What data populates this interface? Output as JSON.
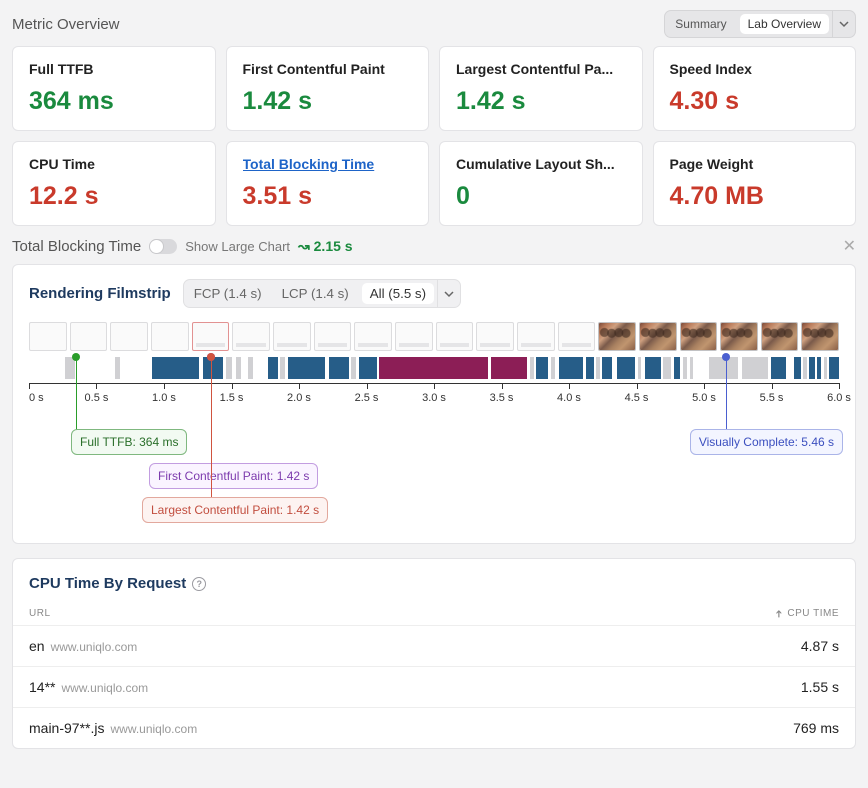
{
  "header": {
    "title": "Metric Overview",
    "tabs": {
      "summary": "Summary",
      "lab": "Lab Overview",
      "active": "lab"
    }
  },
  "metrics": [
    {
      "label": "Full TTFB",
      "value": "364 ms",
      "status": "good",
      "link": false
    },
    {
      "label": "First Contentful Paint",
      "value": "1.42 s",
      "status": "good",
      "link": false
    },
    {
      "label": "Largest Contentful Pa...",
      "value": "1.42 s",
      "status": "good",
      "link": false
    },
    {
      "label": "Speed Index",
      "value": "4.30 s",
      "status": "bad",
      "link": false
    },
    {
      "label": "CPU Time",
      "value": "12.2 s",
      "status": "bad",
      "link": false
    },
    {
      "label": "Total Blocking Time",
      "value": "3.51 s",
      "status": "bad",
      "link": true
    },
    {
      "label": "Cumulative Layout Sh...",
      "value": "0",
      "status": "good",
      "link": false
    },
    {
      "label": "Page Weight",
      "value": "4.70 MB",
      "status": "bad",
      "link": false
    }
  ],
  "tbt": {
    "title": "Total Blocking Time",
    "toggle_label": "Show Large Chart",
    "delta": "2.15 s",
    "delta_icon": "↝"
  },
  "rendering": {
    "title": "Rendering Filmstrip",
    "tabs": {
      "fcp": "FCP (1.4 s)",
      "lcp": "LCP (1.4 s)",
      "all": "All (5.5 s)",
      "active": "all"
    },
    "thumbs": [
      {
        "kind": "blank"
      },
      {
        "kind": "blank"
      },
      {
        "kind": "blank"
      },
      {
        "kind": "blank"
      },
      {
        "kind": "hl"
      },
      {
        "kind": "shade"
      },
      {
        "kind": "shade"
      },
      {
        "kind": "shade"
      },
      {
        "kind": "shade"
      },
      {
        "kind": "shade"
      },
      {
        "kind": "shade"
      },
      {
        "kind": "shade"
      },
      {
        "kind": "shade"
      },
      {
        "kind": "shade"
      },
      {
        "kind": "photo"
      },
      {
        "kind": "photo"
      },
      {
        "kind": "photo"
      },
      {
        "kind": "photo"
      },
      {
        "kind": "photo"
      },
      {
        "kind": "photo"
      }
    ],
    "activity": [
      {
        "c": "grey",
        "l": 4.5,
        "w": 1.2
      },
      {
        "c": "grey",
        "l": 10.6,
        "w": 0.6
      },
      {
        "c": "blue",
        "l": 15.2,
        "w": 5.8
      },
      {
        "c": "blue",
        "l": 21.5,
        "w": 2.4
      },
      {
        "c": "grey",
        "l": 24.3,
        "w": 0.8
      },
      {
        "c": "grey",
        "l": 25.6,
        "w": 0.6
      },
      {
        "c": "grey",
        "l": 27.0,
        "w": 0.6
      },
      {
        "c": "blue",
        "l": 29.5,
        "w": 1.2
      },
      {
        "c": "grey",
        "l": 31.0,
        "w": 0.6
      },
      {
        "c": "blue",
        "l": 32.0,
        "w": 4.5
      },
      {
        "c": "blue",
        "l": 37.0,
        "w": 2.5
      },
      {
        "c": "grey",
        "l": 39.8,
        "w": 0.6
      },
      {
        "c": "blue",
        "l": 40.8,
        "w": 2.2
      },
      {
        "c": "mag",
        "l": 43.2,
        "w": 13.5
      },
      {
        "c": "mag",
        "l": 57.0,
        "w": 4.5
      },
      {
        "c": "grey",
        "l": 61.8,
        "w": 0.5
      },
      {
        "c": "blue",
        "l": 62.6,
        "w": 1.5
      },
      {
        "c": "grey",
        "l": 64.4,
        "w": 0.6
      },
      {
        "c": "blue",
        "l": 65.4,
        "w": 3.0
      },
      {
        "c": "blue",
        "l": 68.8,
        "w": 1.0
      },
      {
        "c": "grey",
        "l": 70.0,
        "w": 0.5
      },
      {
        "c": "blue",
        "l": 70.8,
        "w": 1.2
      },
      {
        "c": "blue",
        "l": 72.6,
        "w": 2.2
      },
      {
        "c": "grey",
        "l": 75.2,
        "w": 0.4
      },
      {
        "c": "blue",
        "l": 76.0,
        "w": 2.0
      },
      {
        "c": "grey",
        "l": 78.3,
        "w": 1.0
      },
      {
        "c": "blue",
        "l": 79.6,
        "w": 0.8
      },
      {
        "c": "grey",
        "l": 80.8,
        "w": 0.4
      },
      {
        "c": "grey",
        "l": 81.6,
        "w": 0.4
      },
      {
        "c": "grey",
        "l": 84.0,
        "w": 3.5
      },
      {
        "c": "grey",
        "l": 88.0,
        "w": 3.2
      },
      {
        "c": "blue",
        "l": 91.6,
        "w": 1.8
      },
      {
        "c": "blue",
        "l": 94.4,
        "w": 0.9
      },
      {
        "c": "grey",
        "l": 95.6,
        "w": 0.5
      },
      {
        "c": "blue",
        "l": 96.3,
        "w": 0.7
      },
      {
        "c": "blue",
        "l": 97.3,
        "w": 0.5
      },
      {
        "c": "grey",
        "l": 98.1,
        "w": 0.4
      },
      {
        "c": "blue",
        "l": 98.8,
        "w": 1.2
      }
    ],
    "ticks": [
      "0 s",
      "0.5 s",
      "1.0 s",
      "1.5 s",
      "2.0 s",
      "2.5 s",
      "3.0 s",
      "3.5 s",
      "4.0 s",
      "4.5 s",
      "5.0 s",
      "5.5 s",
      "6.0 s"
    ],
    "markers": {
      "ttfb": {
        "pct": 5.8,
        "label": "Full TTFB: 364 ms",
        "color": "#2a9d2a"
      },
      "fcp": {
        "pct": 22.5,
        "label": "First Contentful Paint: 1.42 s",
        "color": "#8a3fbf"
      },
      "lcp": {
        "pct": 22.5,
        "label": "Largest Contentful Paint: 1.42 s",
        "color": "#d0543f"
      },
      "vc": {
        "pct": 86.0,
        "label": "Visually Complete: 5.46 s",
        "color": "#4a5fd0"
      }
    }
  },
  "cpu": {
    "title": "CPU Time By Request",
    "columns": {
      "url": "URL",
      "time": "CPU TIME"
    },
    "rows": [
      {
        "name": "en",
        "host": "www.uniqlo.com",
        "time": "4.87 s"
      },
      {
        "name": "14**",
        "host": "www.uniqlo.com",
        "time": "1.55 s"
      },
      {
        "name": "main-97**.js",
        "host": "www.uniqlo.com",
        "time": "769 ms"
      }
    ]
  }
}
